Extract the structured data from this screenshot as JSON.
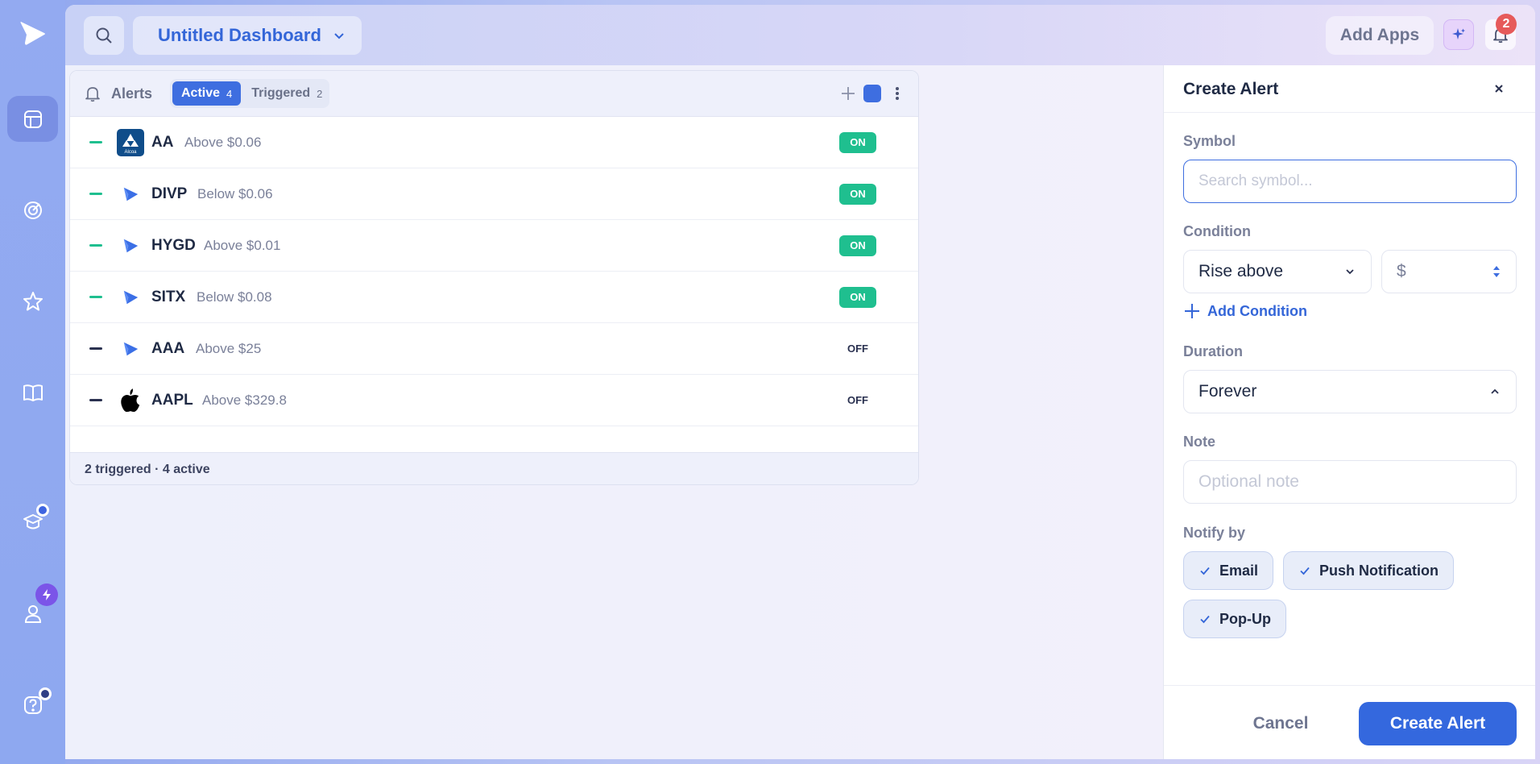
{
  "header": {
    "dashboard_title": "Untitled Dashboard",
    "add_apps_label": "Add Apps",
    "notification_count": "2"
  },
  "alerts_widget": {
    "title": "Alerts",
    "tabs": [
      {
        "label": "Active",
        "count": "4"
      },
      {
        "label": "Triggered",
        "count": "2"
      }
    ],
    "rows": [
      {
        "symbol": "AA",
        "condition": "Above $0.06",
        "status": "ON",
        "logo": "alcoa-logo",
        "logo_text": "Alcoa"
      },
      {
        "symbol": "DIVP",
        "condition": "Below $0.06",
        "status": "ON",
        "logo": "play-logo"
      },
      {
        "symbol": "HYGD",
        "condition": "Above $0.01",
        "status": "ON",
        "logo": "play-logo"
      },
      {
        "symbol": "SITX",
        "condition": "Below $0.08",
        "status": "ON",
        "logo": "play-logo"
      },
      {
        "symbol": "AAA",
        "condition": "Above $25",
        "status": "OFF",
        "logo": "play-logo"
      },
      {
        "symbol": "AAPL",
        "condition": "Above $329.8",
        "status": "OFF",
        "logo": "apple-logo"
      }
    ],
    "footer": "2 triggered · 4 active"
  },
  "create_alert": {
    "title": "Create Alert",
    "symbol_label": "Symbol",
    "symbol_placeholder": "Search symbol...",
    "condition_label": "Condition",
    "condition_value": "Rise above",
    "price_prefix": "$",
    "add_condition_label": "Add Condition",
    "duration_label": "Duration",
    "duration_value": "Forever",
    "note_label": "Note",
    "note_placeholder": "Optional note",
    "notify_label": "Notify by",
    "notify_options": [
      "Email",
      "Push Notification",
      "Pop-Up"
    ],
    "cancel_label": "Cancel",
    "submit_label": "Create Alert"
  },
  "colors": {
    "accent": "#3e6ee0",
    "on_green": "#1fbf8f",
    "badge_red": "#e65a5a"
  }
}
